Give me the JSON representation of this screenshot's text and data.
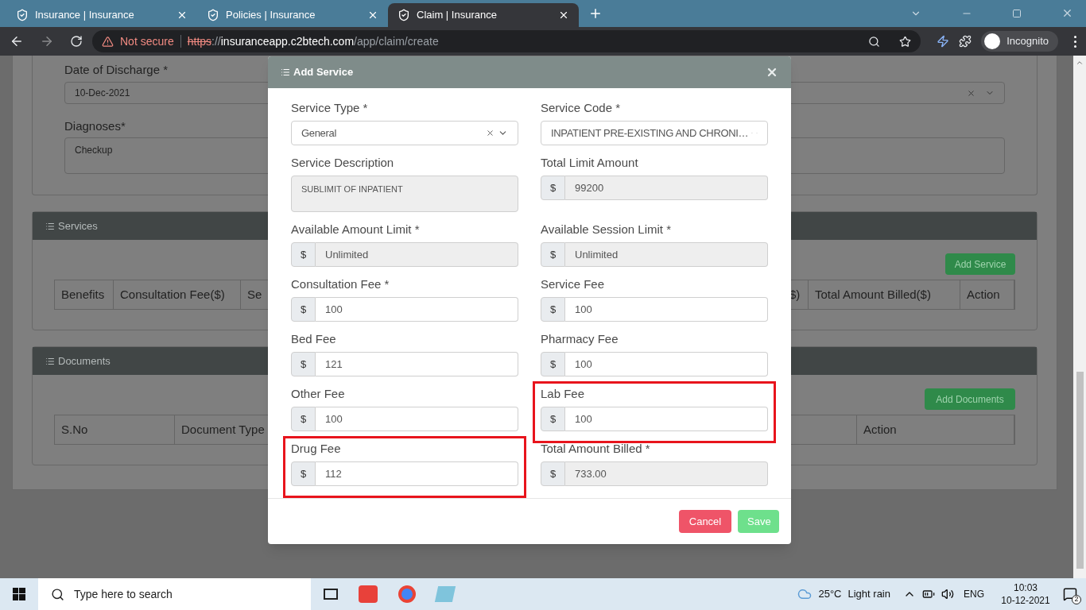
{
  "browser": {
    "tabs": [
      {
        "title": "Insurance | Insurance",
        "selected": false
      },
      {
        "title": "Policies | Insurance",
        "selected": false
      },
      {
        "title": "Claim | Insurance",
        "selected": true
      }
    ],
    "security": "Not secure",
    "url": {
      "scheme": "https",
      "separator": "://",
      "host": "insuranceapp.c2btech.com",
      "path": "/app/claim/create"
    },
    "profile": "Incognito"
  },
  "page": {
    "discharge": {
      "label": "Date of Discharge *",
      "value": "10-Dec-2021"
    },
    "diagnoses": {
      "label": "Diagnoses*",
      "value": "Checkup"
    },
    "services": {
      "title": "Services",
      "button": "Add Service",
      "columns_left": [
        "Benefits",
        "Consultation Fee($)",
        "Se"
      ],
      "columns_right": [
        "$)",
        "Total Amount Billed($)",
        "Action"
      ]
    },
    "documents": {
      "title": "Documents",
      "button": "Add Documents",
      "columns_left": [
        "S.No",
        "Document Type"
      ],
      "columns_right": [
        "Action"
      ]
    }
  },
  "modal": {
    "title": "Add Service",
    "fields": [
      {
        "label": "Service Type *",
        "kind": "select",
        "value": "General",
        "readonly": false,
        "highlighted": false
      },
      {
        "label": "Service Code *",
        "kind": "select",
        "value": "INPATIENT PRE-EXISTING AND CHRONI…",
        "readonly": false,
        "highlighted": false
      },
      {
        "label": "Service Description",
        "kind": "textarea",
        "value": "SUBLIMIT OF INPATIENT",
        "readonly": true,
        "highlighted": false
      },
      {
        "label": "Total Limit Amount",
        "kind": "amount",
        "prefix": "$",
        "value": "99200",
        "readonly": true,
        "highlighted": false
      },
      {
        "label": "Available Amount Limit *",
        "kind": "amount",
        "prefix": "$",
        "value": "Unlimited",
        "readonly": true,
        "highlighted": false
      },
      {
        "label": "Available Session Limit *",
        "kind": "amount",
        "prefix": "$",
        "value": "Unlimited",
        "readonly": true,
        "highlighted": false
      },
      {
        "label": "Consultation Fee *",
        "kind": "amount",
        "prefix": "$",
        "value": "100",
        "readonly": false,
        "highlighted": false
      },
      {
        "label": "Service Fee",
        "kind": "amount",
        "prefix": "$",
        "value": "100",
        "readonly": false,
        "highlighted": false
      },
      {
        "label": "Bed Fee",
        "kind": "amount",
        "prefix": "$",
        "value": "121",
        "readonly": false,
        "highlighted": false
      },
      {
        "label": "Pharmacy Fee",
        "kind": "amount",
        "prefix": "$",
        "value": "100",
        "readonly": false,
        "highlighted": false
      },
      {
        "label": "Other Fee",
        "kind": "amount",
        "prefix": "$",
        "value": "100",
        "readonly": false,
        "highlighted": false
      },
      {
        "label": "Lab Fee",
        "kind": "amount",
        "prefix": "$",
        "value": "100",
        "readonly": false,
        "highlighted": true
      },
      {
        "label": "Drug Fee",
        "kind": "amount",
        "prefix": "$",
        "value": "112",
        "readonly": false,
        "highlighted": true
      },
      {
        "label": "Total Amount Billed *",
        "kind": "amount",
        "prefix": "$",
        "value": "733.00",
        "readonly": true,
        "highlighted": false
      }
    ],
    "buttons": [
      {
        "label": "Cancel",
        "kind": "danger"
      },
      {
        "label": "Save",
        "kind": "success"
      }
    ]
  },
  "taskbar": {
    "search_placeholder": "Type here to search",
    "temperature": "25°C",
    "weather": "Light rain",
    "language": "ENG",
    "time": "10:03",
    "date": "10-12-2021",
    "notifications": "2"
  }
}
